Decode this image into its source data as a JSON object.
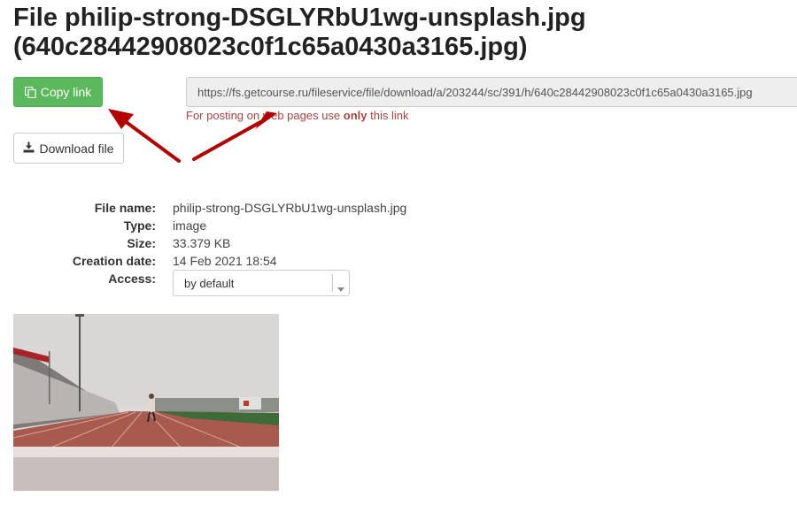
{
  "page": {
    "title": "File philip-strong-DSGLYRbU1wg-unsplash.jpg (640c28442908023c0f1c65a0430a3165.jpg)"
  },
  "actions": {
    "copy_link_label": "Copy link",
    "download_label": "Download file"
  },
  "link": {
    "url": "https://fs.getcourse.ru/fileservice/file/download/a/203244/sc/391/h/640c28442908023c0f1c65a0430a3165.jpg",
    "hint_prefix": "For posting on web pages use ",
    "hint_emphasis": "only",
    "hint_suffix": " this link"
  },
  "details": {
    "file_name_label": "File name:",
    "file_name_value": "philip-strong-DSGLYRbU1wg-unsplash.jpg",
    "type_label": "Type:",
    "type_value": "image",
    "size_label": "Size:",
    "size_value": "33.379 KB",
    "created_label": "Creation date:",
    "created_value": "14 Feb 2021 18:54",
    "access_label": "Access:",
    "access_value": "by default"
  },
  "colors": {
    "primary_button": "#5cb85c",
    "hint_text": "#a94442",
    "annotation_arrow": "#b30000"
  },
  "icons": {
    "copy": "copy-icon",
    "download": "download-icon",
    "dropdown": "caret-down-icon"
  }
}
